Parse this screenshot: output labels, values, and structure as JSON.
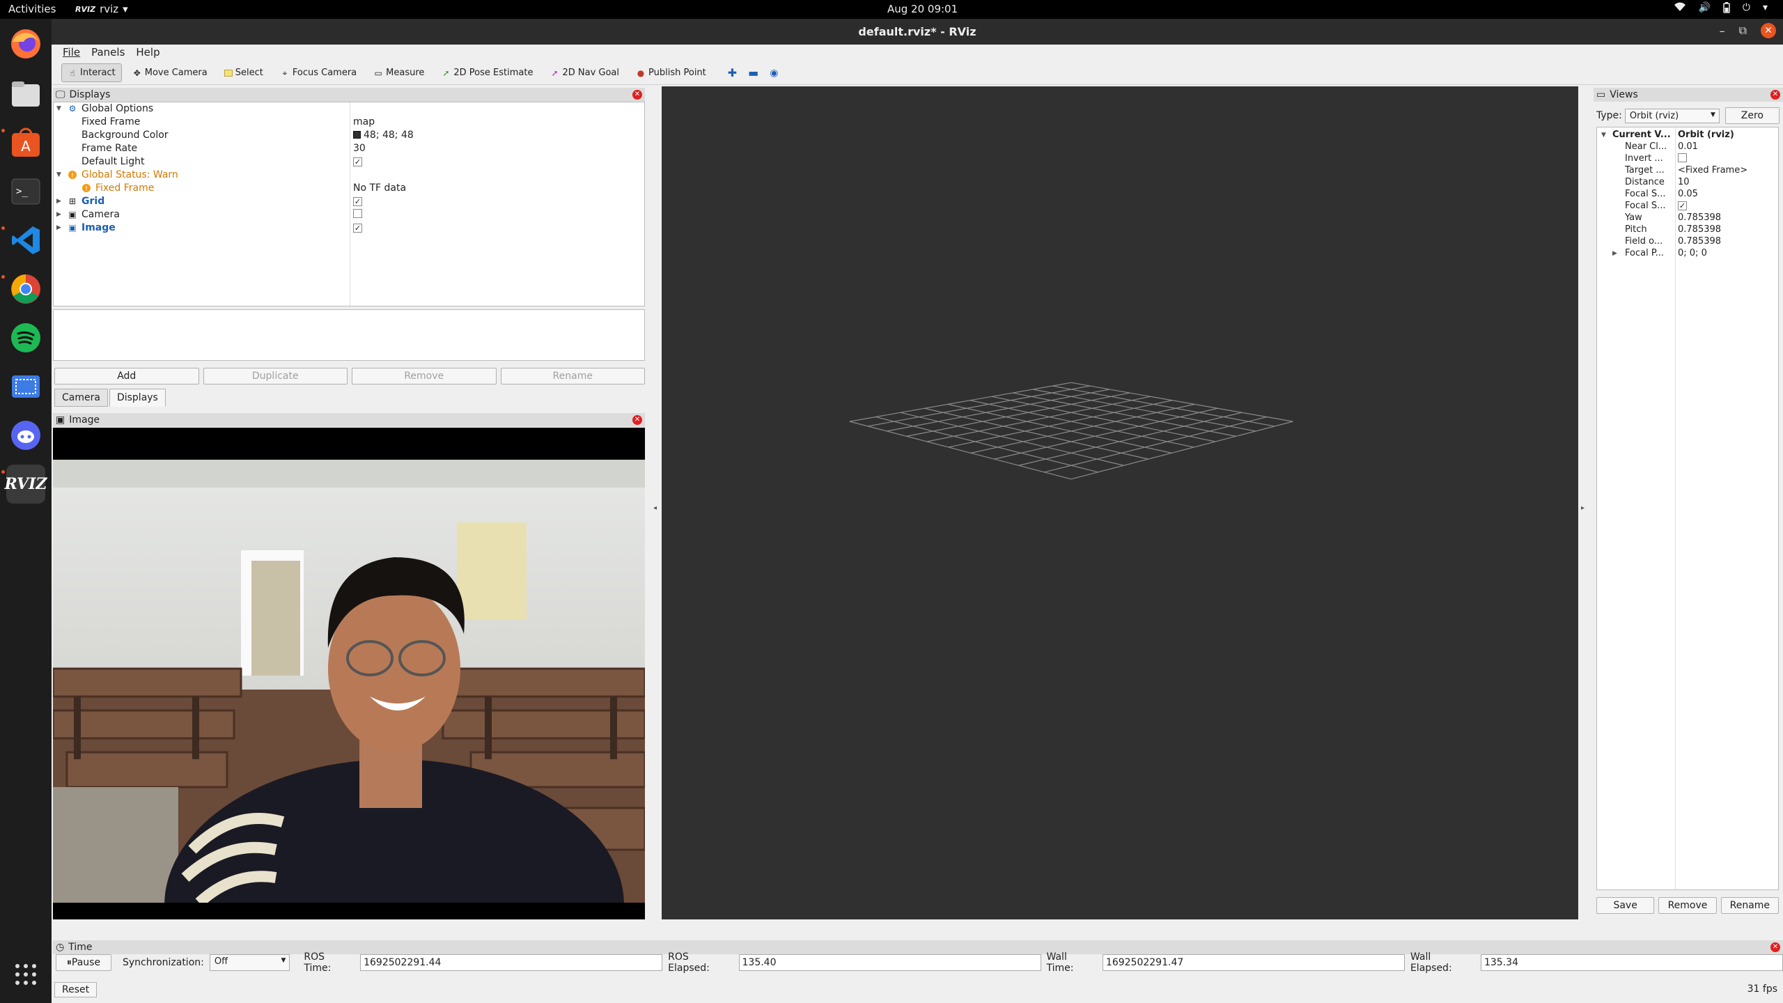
{
  "topbar": {
    "activities": "Activities",
    "app_name": "rviz",
    "app_logo_text": "RVIZ",
    "clock": "Aug 20  09:01"
  },
  "window": {
    "title": "default.rviz* - RViz"
  },
  "menu": {
    "file": "File",
    "panels": "Panels",
    "help": "Help"
  },
  "toolbar": {
    "interact": "Interact",
    "move_camera": "Move Camera",
    "select": "Select",
    "focus_camera": "Focus Camera",
    "measure": "Measure",
    "pose_estimate": "2D Pose Estimate",
    "nav_goal": "2D Nav Goal",
    "publish_point": "Publish Point"
  },
  "displays": {
    "title": "Displays",
    "global_options": "Global Options",
    "fixed_frame_label": "Fixed Frame",
    "fixed_frame_value": "map",
    "background_color_label": "Background Color",
    "background_color_value": "48; 48; 48",
    "background_color_swatch": "#303030",
    "frame_rate_label": "Frame Rate",
    "frame_rate_value": "30",
    "default_light_label": "Default Light",
    "default_light_checked": true,
    "global_status": "Global Status: Warn",
    "status_fixed_frame": "Fixed Frame",
    "status_fixed_frame_value": "No TF data",
    "grid": "Grid",
    "grid_checked": true,
    "camera": "Camera",
    "camera_checked": false,
    "image": "Image",
    "image_checked": true
  },
  "display_buttons": {
    "add": "Add",
    "duplicate": "Duplicate",
    "remove": "Remove",
    "rename": "Rename"
  },
  "tabs": {
    "camera": "Camera",
    "displays": "Displays"
  },
  "image_panel": {
    "title": "Image"
  },
  "views": {
    "title": "Views",
    "type_label": "Type:",
    "type_value": "Orbit (rviz)",
    "zero": "Zero",
    "current_view_label": "Current V...",
    "current_view_value": "Orbit (rviz)",
    "props": [
      {
        "name": "Near Cl...",
        "value": "0.01"
      },
      {
        "name": "Invert ...",
        "value": ""
      },
      {
        "name": "Target ...",
        "value": "<Fixed Frame>"
      },
      {
        "name": "Distance",
        "value": "10"
      },
      {
        "name": "Focal S...",
        "value": "0.05"
      },
      {
        "name": "Focal S...",
        "value": ""
      },
      {
        "name": "Yaw",
        "value": "0.785398"
      },
      {
        "name": "Pitch",
        "value": "0.785398"
      },
      {
        "name": "Field o...",
        "value": "0.785398"
      },
      {
        "name": "Focal P...",
        "value": "0; 0; 0"
      }
    ],
    "save": "Save",
    "remove": "Remove",
    "rename": "Rename"
  },
  "time": {
    "title": "Time",
    "pause": "Pause",
    "sync_label": "Synchronization:",
    "sync_value": "Off",
    "ros_time_label": "ROS Time:",
    "ros_time": "1692502291.44",
    "ros_elapsed_label": "ROS Elapsed:",
    "ros_elapsed": "135.40",
    "wall_time_label": "Wall Time:",
    "wall_time": "1692502291.47",
    "wall_elapsed_label": "Wall Elapsed:",
    "wall_elapsed": "135.34",
    "reset": "Reset",
    "fps": "31 fps"
  },
  "colors": {
    "accent": "#e95420",
    "viewport_bg": "#303030",
    "warn": "#d47800",
    "link": "#1a5fb4"
  }
}
